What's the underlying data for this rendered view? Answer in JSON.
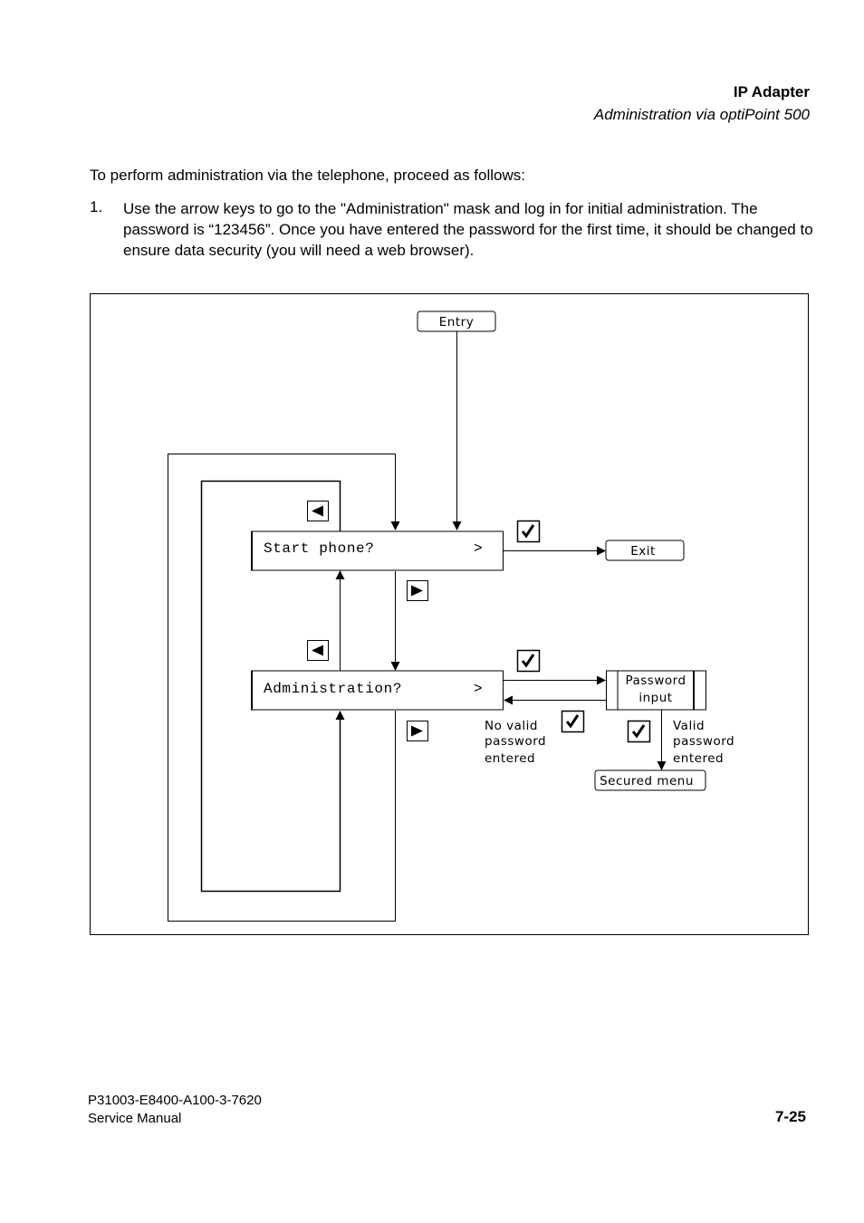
{
  "header": {
    "title": "IP Adapter",
    "subtitle": "Administration via optiPoint 500"
  },
  "body": {
    "intro": "To perform administration via the telephone, proceed as follows:",
    "steps": [
      {
        "number": "1.",
        "text": "Use the arrow keys to go to the \"Administration\" mask and log in for initial administration. The password is “123456”. Once you have entered the password for the first time, it should be changed to ensure data security (you will need a web browser)."
      }
    ]
  },
  "diagram": {
    "entry_label": "Entry",
    "exit_label": "Exit",
    "display_start": {
      "text": "Start phone?",
      "arrow": ">"
    },
    "display_admin": {
      "text": "Administration?",
      "arrow": ">"
    },
    "password_box": {
      "line1": "Password",
      "line2": "input"
    },
    "secured_menu_label": "Secured menu",
    "no_valid": {
      "line1": "No valid",
      "line2": "password",
      "line3": "entered"
    },
    "valid": {
      "line1": "Valid",
      "line2": "password",
      "line3": "entered"
    },
    "keys": {
      "left": "left-arrow-key-icon",
      "right": "right-arrow-key-icon",
      "ok": "checkmark-key-icon"
    }
  },
  "footer": {
    "doc_number": "P31003-E8400-A100-3-7620",
    "manual": "Service Manual",
    "page": "7-25"
  }
}
